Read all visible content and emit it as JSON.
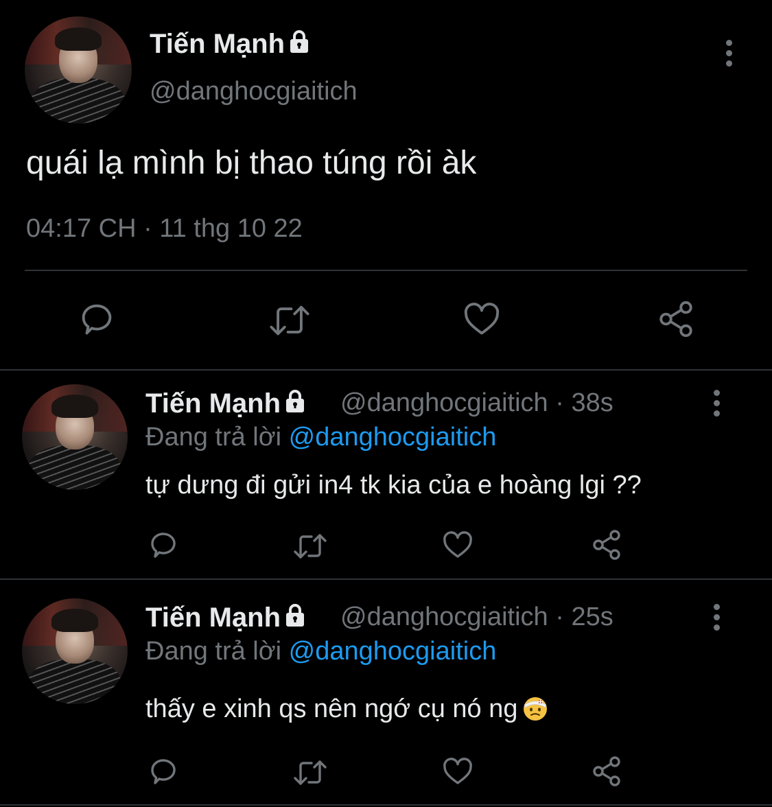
{
  "main_tweet": {
    "author_name": "Tiến Mạnh",
    "handle": "@danghocgiaitich",
    "text": "quái lạ mình bị thao túng rồi àk",
    "timestamp": "04:17 CH · 11 thg 10 22",
    "locked": true
  },
  "replies": [
    {
      "author_name": "Tiến Mạnh",
      "handle": "@danghocgiaitich",
      "time": "· 38s",
      "replying_label": "Đang trả lời",
      "replying_to": "@danghocgiaitich",
      "text": "tự dưng đi gửi in4 tk kia của e hoàng lgi ??",
      "emoji": ""
    },
    {
      "author_name": "Tiến Mạnh",
      "handle": "@danghocgiaitich",
      "time": "· 25s",
      "replying_label": "Đang trả lời",
      "replying_to": "@danghocgiaitich",
      "text": "thấy e xinh qs nên ngớ cụ nó ng",
      "emoji": "face-with-head-bandage"
    }
  ],
  "icons": {
    "reply": "reply-icon",
    "retweet": "retweet-icon",
    "like": "heart-icon",
    "share": "share-icon",
    "more": "more-vertical-icon",
    "lock": "lock-icon"
  },
  "colors": {
    "background": "#000000",
    "text_primary": "#e7e9ea",
    "text_secondary": "#71767b",
    "accent": "#1d9bf0",
    "divider": "#2f3336"
  }
}
